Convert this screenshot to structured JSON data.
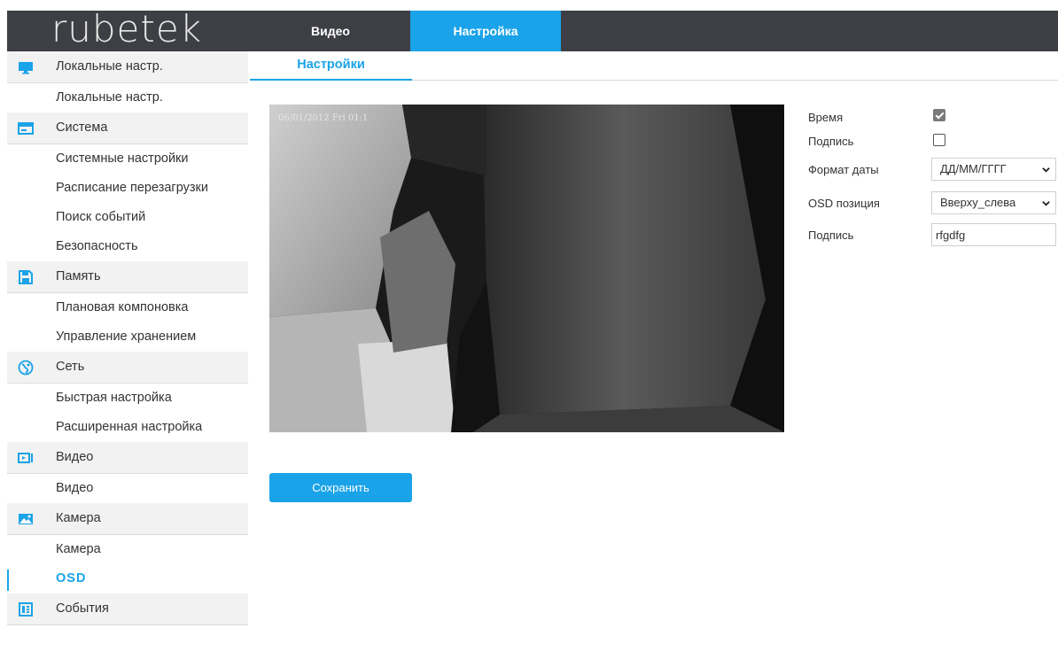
{
  "header": {
    "logo": "rubetek",
    "tabs": [
      {
        "label": "Видео",
        "active": false
      },
      {
        "label": "Настройка",
        "active": true
      }
    ]
  },
  "sidebar": {
    "groups": [
      {
        "label": "Локальные настр.",
        "icon": "monitor-icon",
        "items": [
          "Локальные настр."
        ]
      },
      {
        "label": "Система",
        "icon": "system-window-icon",
        "items": [
          "Системные настройки",
          "Расписание перезагрузки",
          "Поиск событий",
          "Безопасность"
        ]
      },
      {
        "label": "Память",
        "icon": "floppy-disk-icon",
        "items": [
          "Плановая компоновка",
          "Управление хранением"
        ]
      },
      {
        "label": "Сеть",
        "icon": "globe-icon",
        "items": [
          "Быстрая настройка",
          "Расширенная настройка"
        ]
      },
      {
        "label": "Видео",
        "icon": "video-play-icon",
        "items": [
          "Видео"
        ]
      },
      {
        "label": "Камера",
        "icon": "image-icon",
        "items": [
          "Камера",
          "OSD"
        ]
      },
      {
        "label": "События",
        "icon": "events-list-icon",
        "items": []
      }
    ],
    "active_item": "OSD"
  },
  "content": {
    "tab": "Настройки",
    "preview": {
      "osd_text": "06/01/2012 Fri 01:1"
    },
    "form": {
      "time_label": "Время",
      "time_checked": true,
      "caption_toggle_label": "Подпись",
      "caption_checked": false,
      "date_format_label": "Формат даты",
      "date_format_value": "ДД/ММ/ГГГГ",
      "osd_position_label": "OSD позиция",
      "osd_position_value": "Вверху_слева",
      "caption_label": "Подпись",
      "caption_value": "rfgdfg"
    },
    "save_label": "Сохранить"
  },
  "colors": {
    "accent": "#1aa3e8",
    "topbar": "#3d3f45",
    "sidebar_group": "#f2f2f2"
  }
}
